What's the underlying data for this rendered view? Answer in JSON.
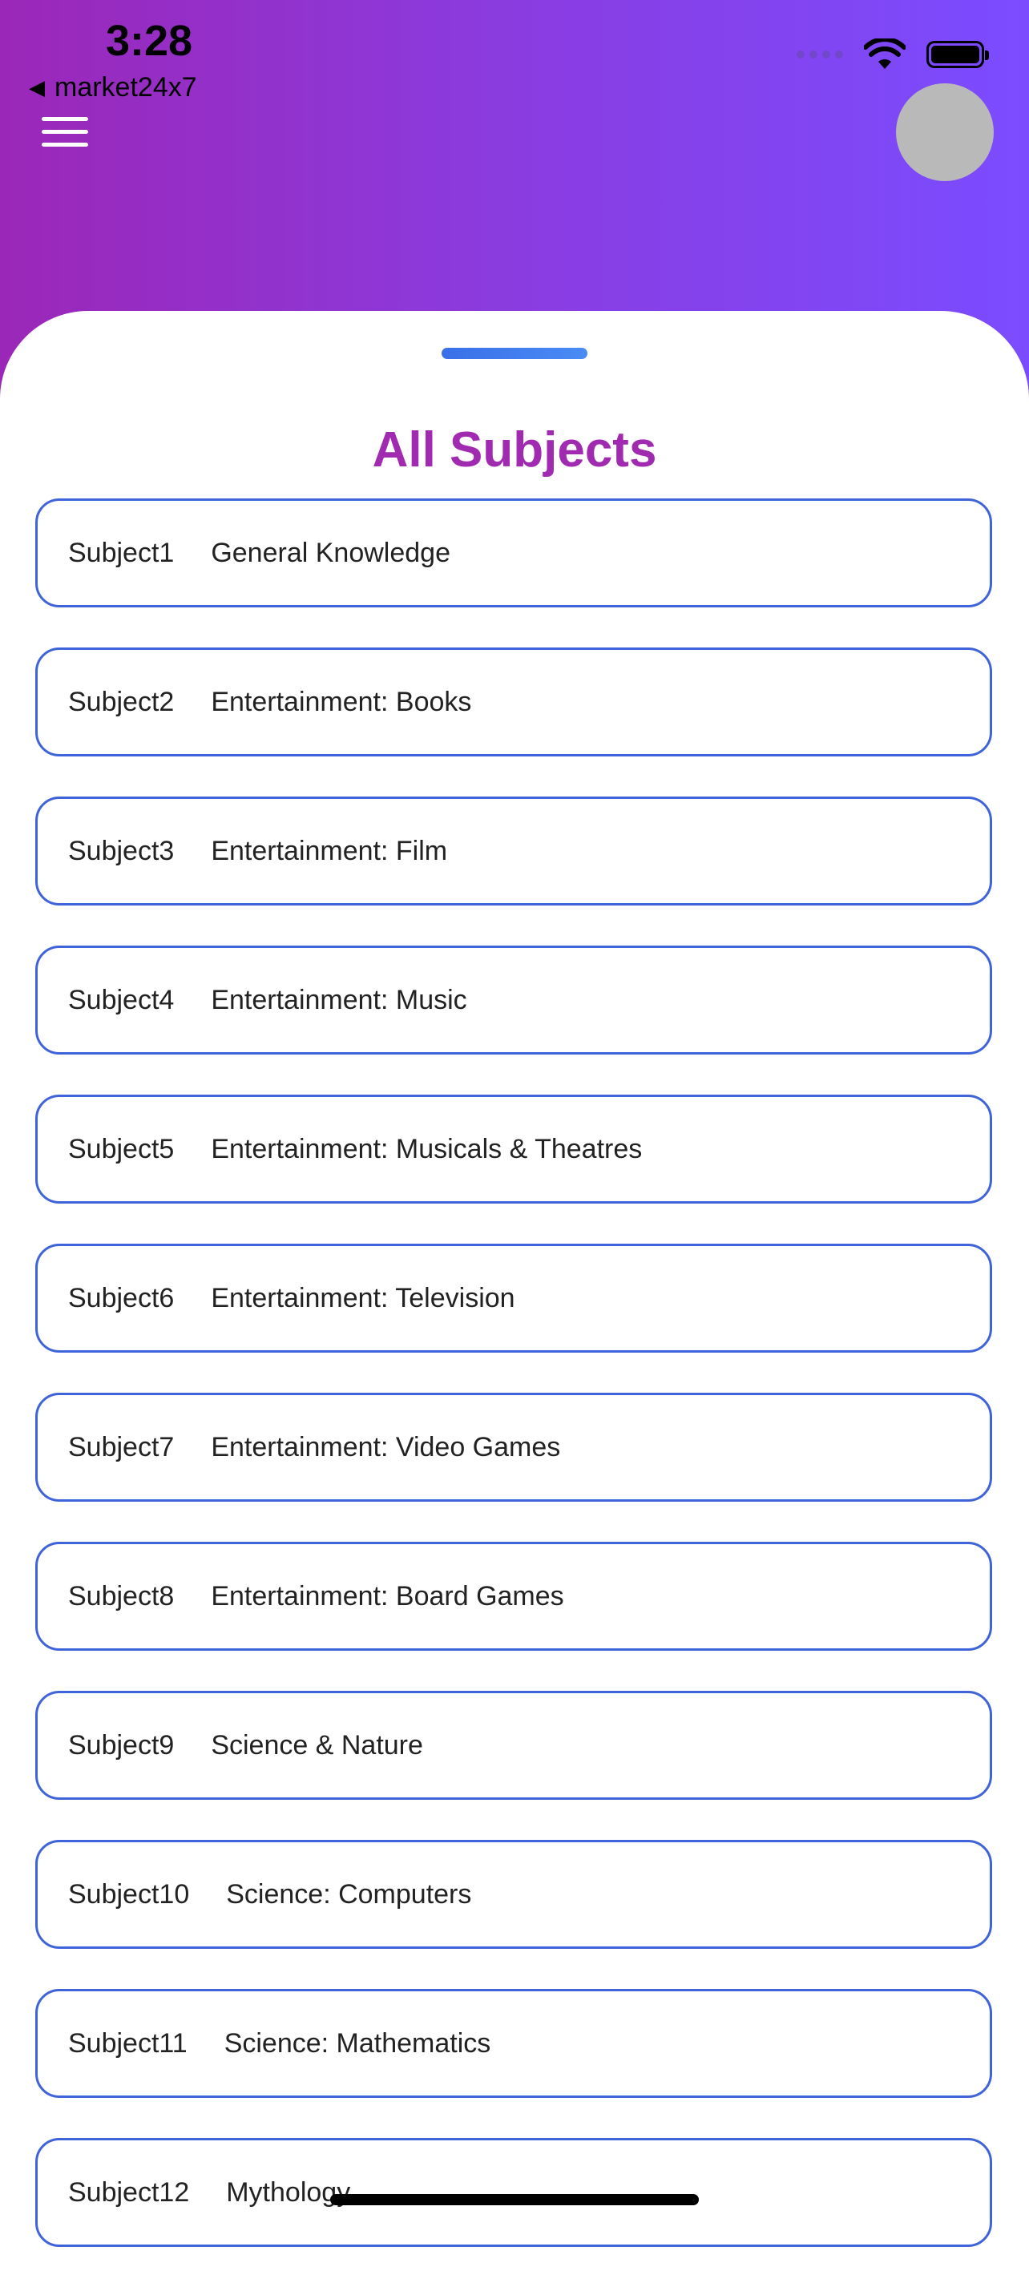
{
  "status_bar": {
    "time": "3:28",
    "back_app": "market24x7"
  },
  "sheet": {
    "title": "All Subjects"
  },
  "subjects": [
    {
      "id": "Subject1",
      "name": "General Knowledge"
    },
    {
      "id": "Subject2",
      "name": "Entertainment: Books"
    },
    {
      "id": "Subject3",
      "name": "Entertainment: Film"
    },
    {
      "id": "Subject4",
      "name": "Entertainment: Music"
    },
    {
      "id": "Subject5",
      "name": "Entertainment: Musicals & Theatres"
    },
    {
      "id": "Subject6",
      "name": "Entertainment: Television"
    },
    {
      "id": "Subject7",
      "name": "Entertainment: Video Games"
    },
    {
      "id": "Subject8",
      "name": "Entertainment: Board Games"
    },
    {
      "id": "Subject9",
      "name": "Science & Nature"
    },
    {
      "id": "Subject10",
      "name": "Science: Computers"
    },
    {
      "id": "Subject11",
      "name": "Science: Mathematics"
    },
    {
      "id": "Subject12",
      "name": "Mythology"
    }
  ],
  "icons": [
    "back-triangle-icon",
    "signal-dots-icon",
    "wifi-icon",
    "battery-icon",
    "hamburger-menu-icon"
  ],
  "colors": {
    "gradient_start": "#9b27b8",
    "gradient_end": "#7b4cff",
    "title": "#a02ab0",
    "border": "#3f63d8"
  }
}
